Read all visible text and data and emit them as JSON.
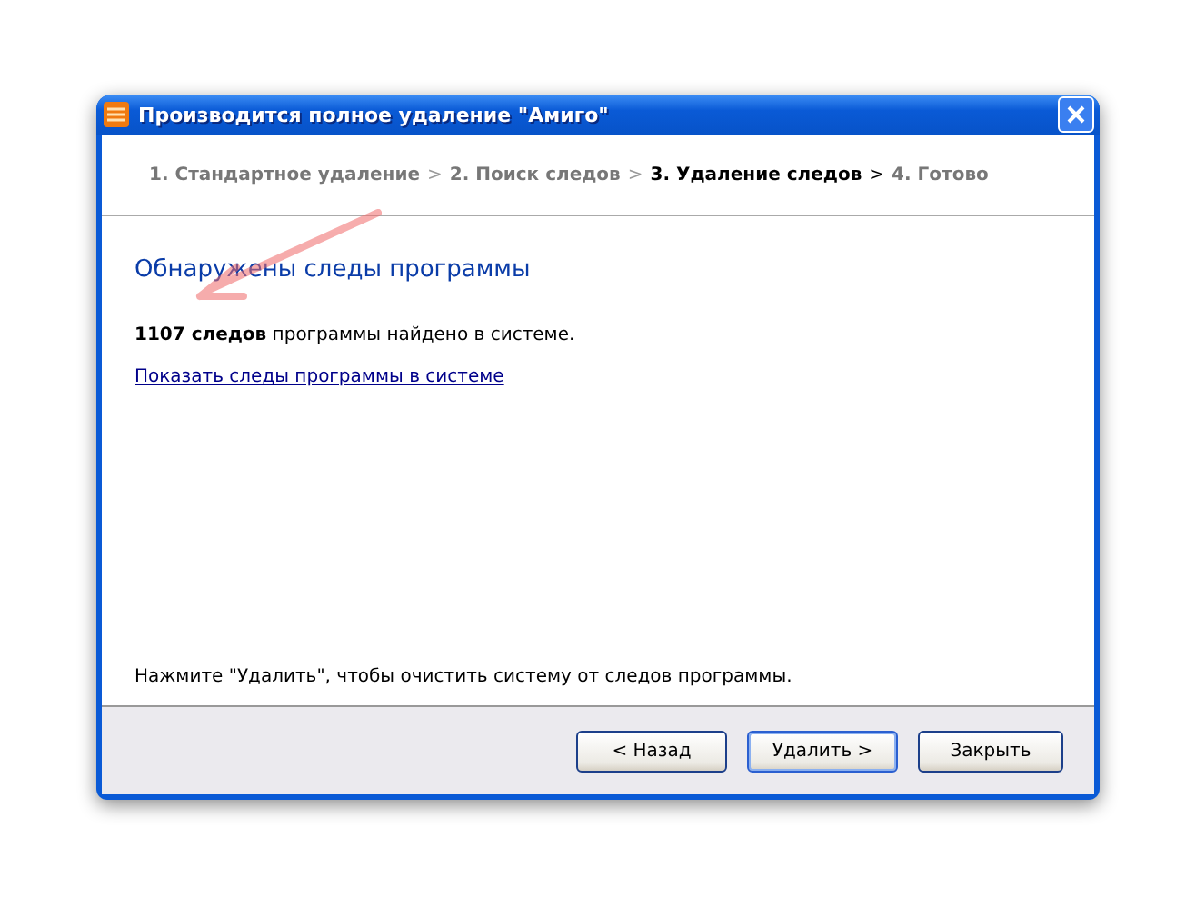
{
  "window": {
    "title": "Производится полное удаление \"Амиго\""
  },
  "steps": [
    {
      "label": "1. Стандартное удаление",
      "selected": false,
      "separator": ">"
    },
    {
      "label": "2. Поиск следов",
      "selected": false,
      "separator": ">"
    },
    {
      "label": "3. Удаление следов",
      "selected": true,
      "separator": ">"
    },
    {
      "label": "4. Готово",
      "selected": false
    }
  ],
  "heading": "Обнаружены следы программы",
  "summary": "**1107 следов** программы найдено в системе.",
  "link": "Показать следы программы в системе",
  "hint": "Нажмите \"Удалить\", чтобы очистить систему от следов программы.",
  "buttons": [
    {
      "label": "< Назад",
      "default": false
    },
    {
      "label": "Удалить >",
      "default": true
    },
    {
      "label": "Закрыть",
      "default": false
    }
  ]
}
